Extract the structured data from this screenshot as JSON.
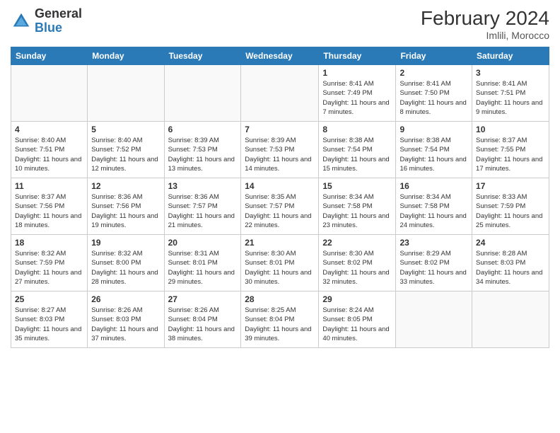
{
  "header": {
    "logo_general": "General",
    "logo_blue": "Blue",
    "month_year": "February 2024",
    "location": "Imlili, Morocco"
  },
  "days_of_week": [
    "Sunday",
    "Monday",
    "Tuesday",
    "Wednesday",
    "Thursday",
    "Friday",
    "Saturday"
  ],
  "weeks": [
    [
      {
        "day": "",
        "info": ""
      },
      {
        "day": "",
        "info": ""
      },
      {
        "day": "",
        "info": ""
      },
      {
        "day": "",
        "info": ""
      },
      {
        "day": "1",
        "info": "Sunrise: 8:41 AM\nSunset: 7:49 PM\nDaylight: 11 hours and 7 minutes."
      },
      {
        "day": "2",
        "info": "Sunrise: 8:41 AM\nSunset: 7:50 PM\nDaylight: 11 hours and 8 minutes."
      },
      {
        "day": "3",
        "info": "Sunrise: 8:41 AM\nSunset: 7:51 PM\nDaylight: 11 hours and 9 minutes."
      }
    ],
    [
      {
        "day": "4",
        "info": "Sunrise: 8:40 AM\nSunset: 7:51 PM\nDaylight: 11 hours and 10 minutes."
      },
      {
        "day": "5",
        "info": "Sunrise: 8:40 AM\nSunset: 7:52 PM\nDaylight: 11 hours and 12 minutes."
      },
      {
        "day": "6",
        "info": "Sunrise: 8:39 AM\nSunset: 7:53 PM\nDaylight: 11 hours and 13 minutes."
      },
      {
        "day": "7",
        "info": "Sunrise: 8:39 AM\nSunset: 7:53 PM\nDaylight: 11 hours and 14 minutes."
      },
      {
        "day": "8",
        "info": "Sunrise: 8:38 AM\nSunset: 7:54 PM\nDaylight: 11 hours and 15 minutes."
      },
      {
        "day": "9",
        "info": "Sunrise: 8:38 AM\nSunset: 7:54 PM\nDaylight: 11 hours and 16 minutes."
      },
      {
        "day": "10",
        "info": "Sunrise: 8:37 AM\nSunset: 7:55 PM\nDaylight: 11 hours and 17 minutes."
      }
    ],
    [
      {
        "day": "11",
        "info": "Sunrise: 8:37 AM\nSunset: 7:56 PM\nDaylight: 11 hours and 18 minutes."
      },
      {
        "day": "12",
        "info": "Sunrise: 8:36 AM\nSunset: 7:56 PM\nDaylight: 11 hours and 19 minutes."
      },
      {
        "day": "13",
        "info": "Sunrise: 8:36 AM\nSunset: 7:57 PM\nDaylight: 11 hours and 21 minutes."
      },
      {
        "day": "14",
        "info": "Sunrise: 8:35 AM\nSunset: 7:57 PM\nDaylight: 11 hours and 22 minutes."
      },
      {
        "day": "15",
        "info": "Sunrise: 8:34 AM\nSunset: 7:58 PM\nDaylight: 11 hours and 23 minutes."
      },
      {
        "day": "16",
        "info": "Sunrise: 8:34 AM\nSunset: 7:58 PM\nDaylight: 11 hours and 24 minutes."
      },
      {
        "day": "17",
        "info": "Sunrise: 8:33 AM\nSunset: 7:59 PM\nDaylight: 11 hours and 25 minutes."
      }
    ],
    [
      {
        "day": "18",
        "info": "Sunrise: 8:32 AM\nSunset: 7:59 PM\nDaylight: 11 hours and 27 minutes."
      },
      {
        "day": "19",
        "info": "Sunrise: 8:32 AM\nSunset: 8:00 PM\nDaylight: 11 hours and 28 minutes."
      },
      {
        "day": "20",
        "info": "Sunrise: 8:31 AM\nSunset: 8:01 PM\nDaylight: 11 hours and 29 minutes."
      },
      {
        "day": "21",
        "info": "Sunrise: 8:30 AM\nSunset: 8:01 PM\nDaylight: 11 hours and 30 minutes."
      },
      {
        "day": "22",
        "info": "Sunrise: 8:30 AM\nSunset: 8:02 PM\nDaylight: 11 hours and 32 minutes."
      },
      {
        "day": "23",
        "info": "Sunrise: 8:29 AM\nSunset: 8:02 PM\nDaylight: 11 hours and 33 minutes."
      },
      {
        "day": "24",
        "info": "Sunrise: 8:28 AM\nSunset: 8:03 PM\nDaylight: 11 hours and 34 minutes."
      }
    ],
    [
      {
        "day": "25",
        "info": "Sunrise: 8:27 AM\nSunset: 8:03 PM\nDaylight: 11 hours and 35 minutes."
      },
      {
        "day": "26",
        "info": "Sunrise: 8:26 AM\nSunset: 8:03 PM\nDaylight: 11 hours and 37 minutes."
      },
      {
        "day": "27",
        "info": "Sunrise: 8:26 AM\nSunset: 8:04 PM\nDaylight: 11 hours and 38 minutes."
      },
      {
        "day": "28",
        "info": "Sunrise: 8:25 AM\nSunset: 8:04 PM\nDaylight: 11 hours and 39 minutes."
      },
      {
        "day": "29",
        "info": "Sunrise: 8:24 AM\nSunset: 8:05 PM\nDaylight: 11 hours and 40 minutes."
      },
      {
        "day": "",
        "info": ""
      },
      {
        "day": "",
        "info": ""
      }
    ]
  ]
}
